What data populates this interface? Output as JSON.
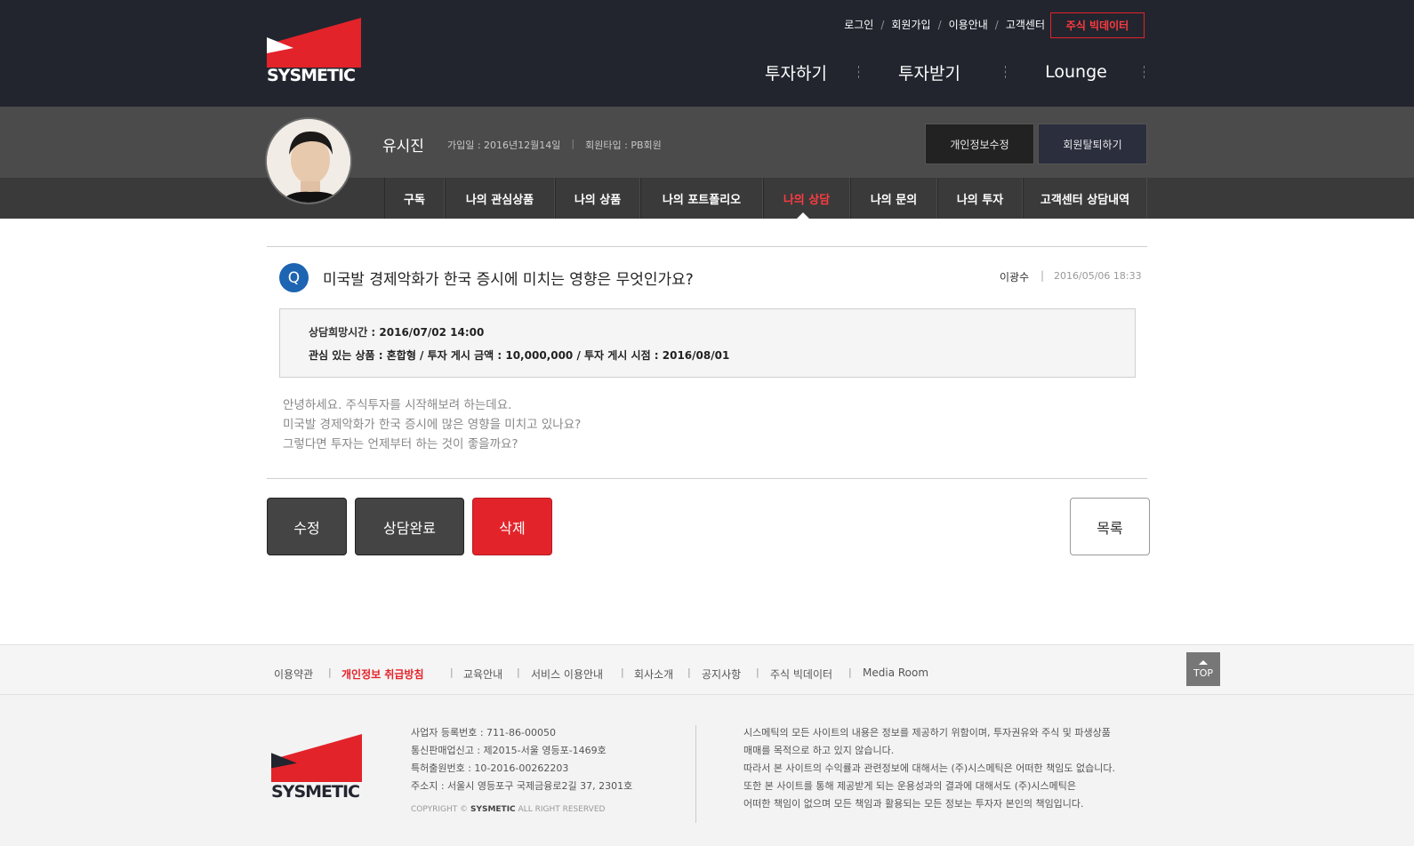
{
  "brand": {
    "name": "SYSMETIC",
    "color": "#e3232a",
    "dark": "#22252e"
  },
  "utility": [
    "로그인",
    "회원가입",
    "이용안내",
    "고객센터"
  ],
  "bigdata_button": "주식 빅데이터",
  "gnb": [
    "투자하기",
    "투자받기",
    "Lounge"
  ],
  "profile": {
    "name": "유시진",
    "join_date": "가입일 : 2016년12월14일",
    "member_type": "회원타입 : PB회원",
    "edit_button": "개인정보수정",
    "withdraw_button": "회원탈퇴하기"
  },
  "subnav": [
    "구독",
    "나의 관심상품",
    "나의 상품",
    "나의 포트폴리오",
    "나의 상담",
    "나의 문의",
    "나의 투자",
    "고객센터 상담내역"
  ],
  "question": {
    "badge": "Q",
    "title": "미국발 경제악화가 한국 증시에 미치는 영향은 무엇인가요?",
    "author": "이광수",
    "separator": "|",
    "date": "2016/05/06 18:33",
    "info_line1_label": "상담희망시간 : ",
    "info_line1_value": "2016/07/02 14:00",
    "info_line2": "관심 있는 상품 : 혼합형 /  투자 게시 금액 : 10,000,000  /  투자 게시 시점 : 2016/08/01",
    "body": [
      "안녕하세요. 주식투자를 시작해보려 하는데요.",
      "미국발 경제악화가 한국 증시에 많은 영향을 미치고 있나요?",
      "그렇다면 투자는 언제부터 하는 것이 좋을까요?"
    ]
  },
  "actions": {
    "edit": "수정",
    "complete": "상담완료",
    "delete": "삭제",
    "list": "목록"
  },
  "footer_nav": [
    "이용약관",
    "개인정보 취급방침",
    "교육안내",
    "서비스 이용안내",
    "회사소개",
    "공지사항",
    "주식 빅데이터",
    "Media Room"
  ],
  "top_button": "TOP",
  "footer_info": [
    "사업자 등록번호 : 711-86-00050",
    "통신판매업신고 : 제2015-서울 영등포-1469호",
    "특허출원번호 : 10-2016-00262203",
    "주소지 : 서울시 영등포구 국제금융로2길 37, 2301호"
  ],
  "copyright_prefix": "COPYRIGHT © ",
  "copyright_brand": "SYSMETIC",
  "copyright_suffix": " ALL RIGHT RESERVED",
  "footer_notice": [
    "시스메틱의 모든 사이트의 내용은 정보를 제공하기 위함이며, 투자권유와 주식 및 파생상품",
    "매매를 목적으로 하고 있지 않습니다.",
    "따라서 본 사이트의 수익률과 관련정보에 대해서는 (주)시스메틱은 어떠한 책임도 없습니다.",
    "또한 본 사이트를 통해 제공받게 되는 운용성과의 결과에 대해서도 (주)시스메틱은",
    "어떠한 책임이 없으며 모든 책임과 활용되는 모든 정보는 투자자 본인의 책임입니다."
  ]
}
